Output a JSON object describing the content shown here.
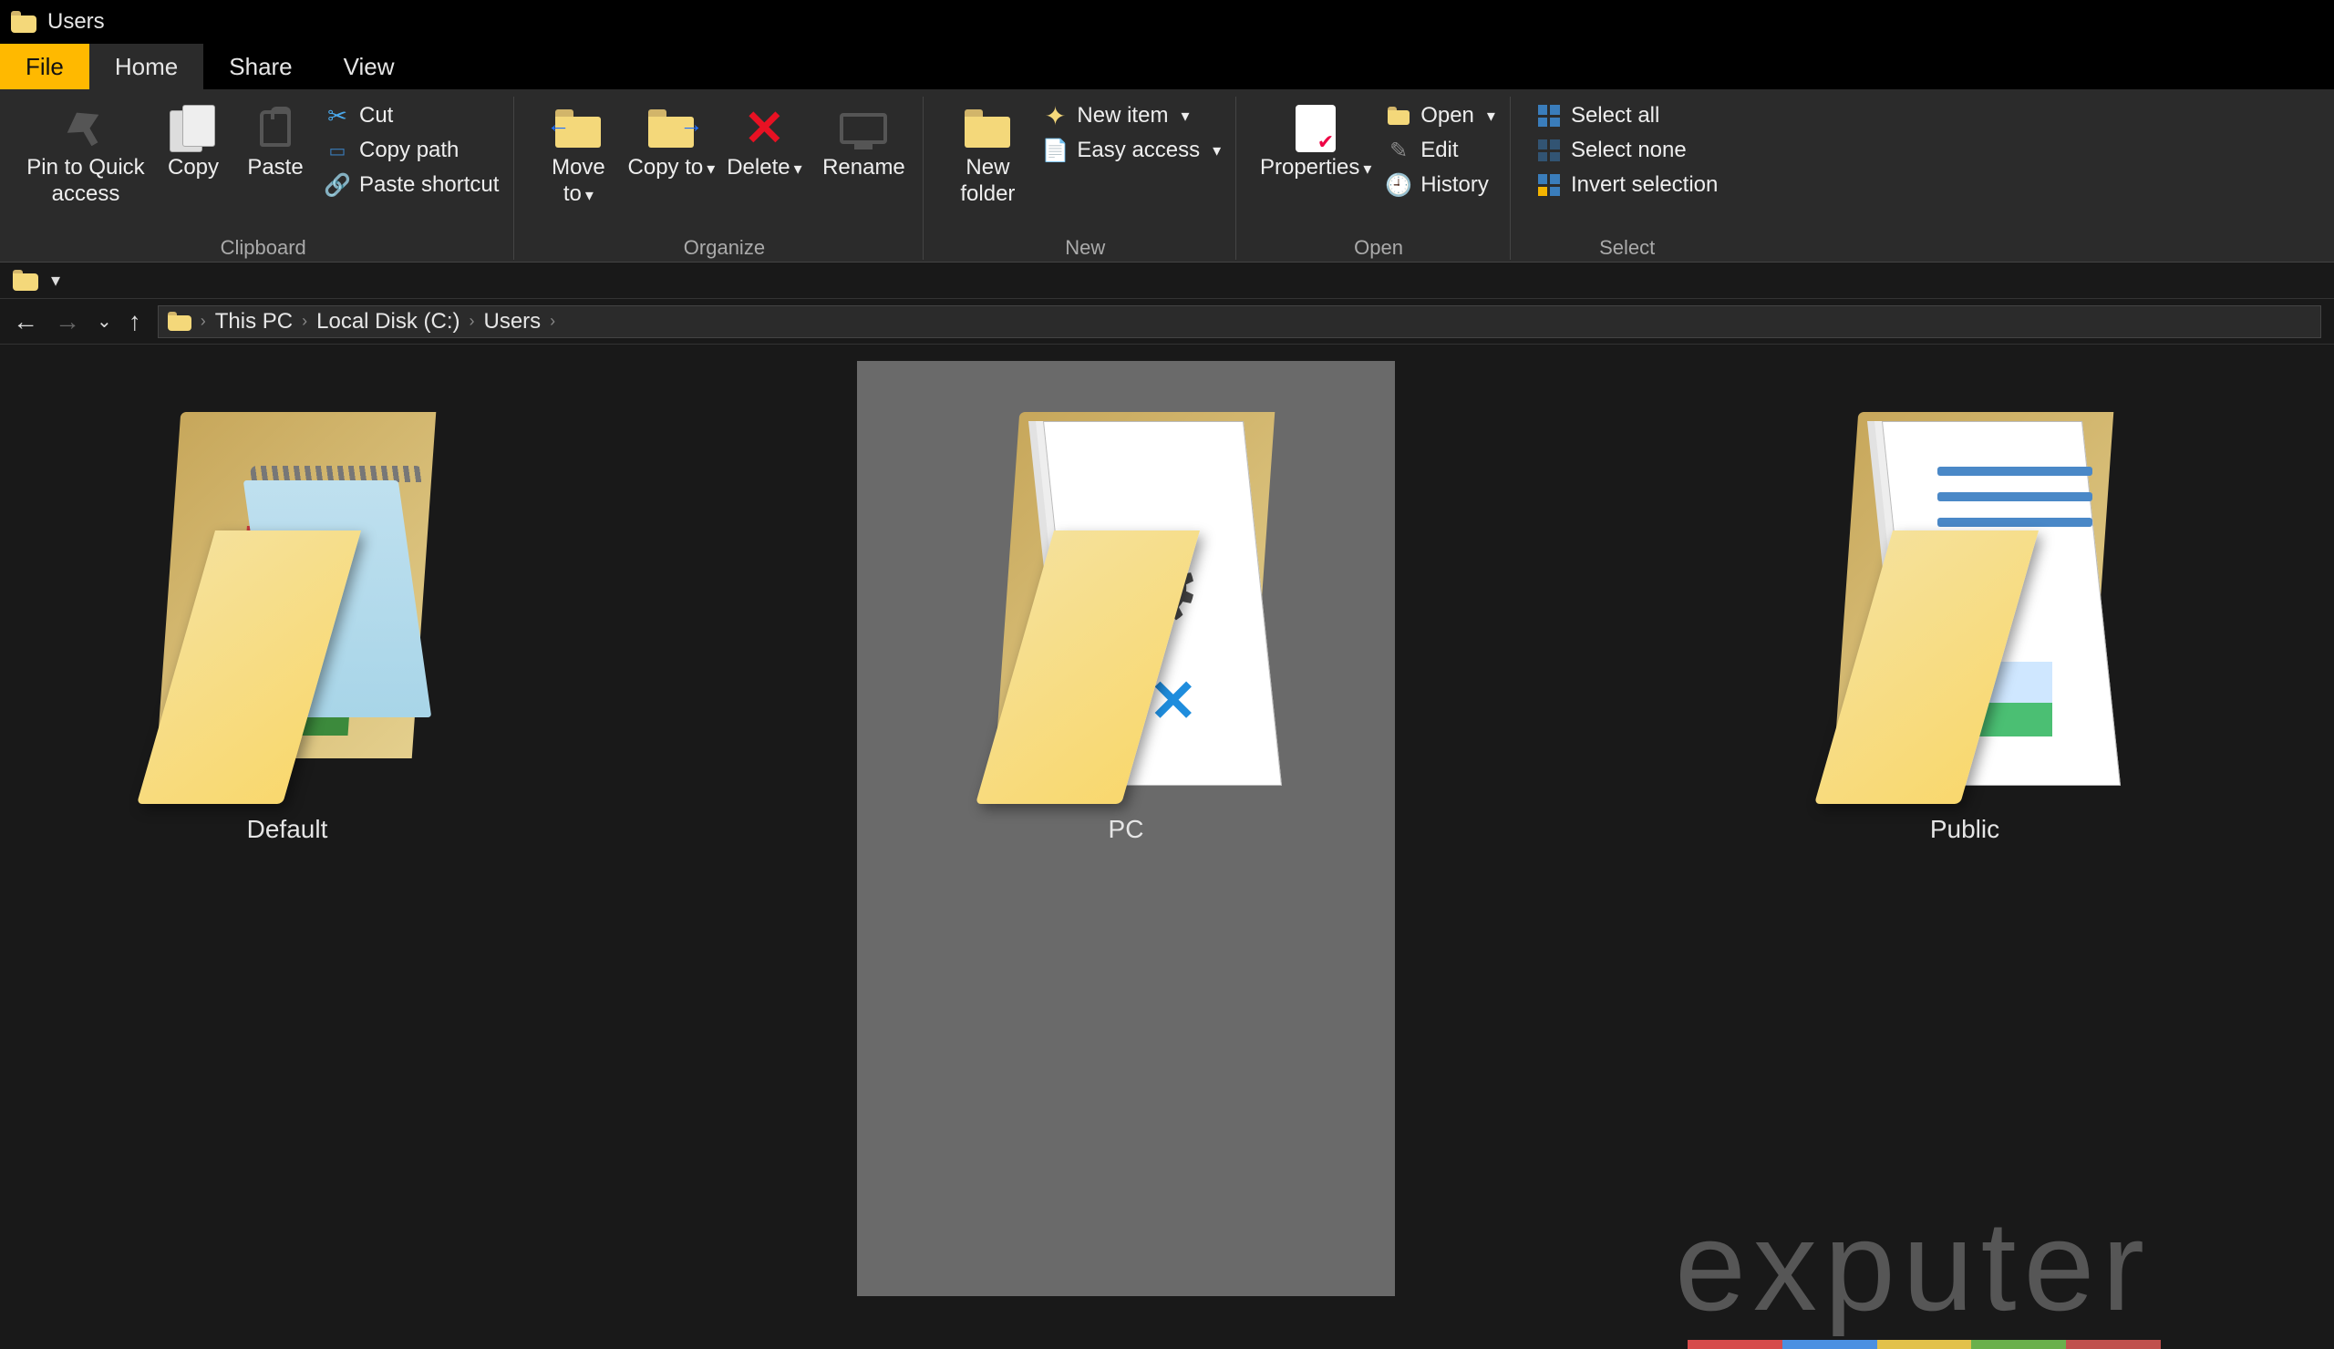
{
  "title": "Users",
  "tabs": {
    "file": "File",
    "home": "Home",
    "share": "Share",
    "view": "View"
  },
  "ribbon": {
    "clipboard": {
      "label": "Clipboard",
      "pin": "Pin to Quick access",
      "copy": "Copy",
      "paste": "Paste",
      "cut": "Cut",
      "copy_path": "Copy path",
      "paste_shortcut": "Paste shortcut"
    },
    "organize": {
      "label": "Organize",
      "move_to": "Move to",
      "copy_to": "Copy to",
      "delete": "Delete",
      "rename": "Rename"
    },
    "new": {
      "label": "New",
      "new_folder": "New folder",
      "new_item": "New item",
      "easy_access": "Easy access"
    },
    "open": {
      "label": "Open",
      "properties": "Properties",
      "open": "Open",
      "edit": "Edit",
      "history": "History"
    },
    "select": {
      "label": "Select",
      "select_all": "Select all",
      "select_none": "Select none",
      "invert": "Invert selection"
    }
  },
  "breadcrumbs": {
    "root": "This PC",
    "drive": "Local Disk (C:)",
    "folder": "Users"
  },
  "items": [
    {
      "name": "Default"
    },
    {
      "name": "PC"
    },
    {
      "name": "Public"
    }
  ],
  "watermark": "exputer"
}
